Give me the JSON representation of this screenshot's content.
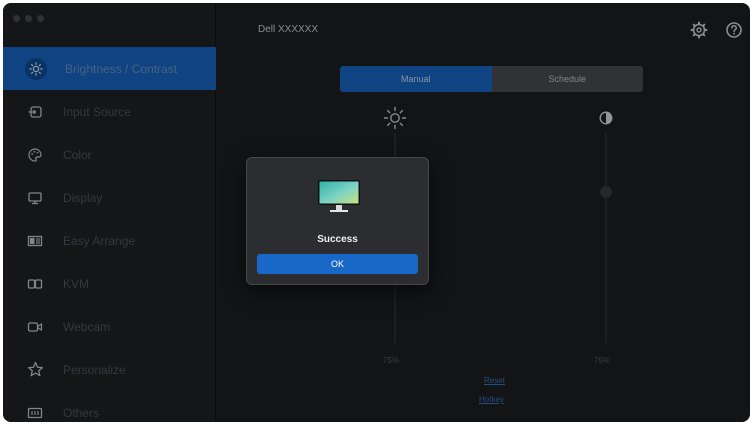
{
  "window": {
    "traffic_lights": [
      "close",
      "minimize",
      "zoom"
    ]
  },
  "header": {
    "monitor_name": "Dell XXXXXX",
    "settings_icon": "gear-icon",
    "help_icon": "help-icon"
  },
  "sidebar": {
    "items": [
      {
        "label": "Brightness / Contrast",
        "icon": "brightness-icon",
        "active": true
      },
      {
        "label": "Input Source",
        "icon": "input-source-icon",
        "active": false
      },
      {
        "label": "Color",
        "icon": "color-palette-icon",
        "active": false
      },
      {
        "label": "Display",
        "icon": "display-icon",
        "active": false
      },
      {
        "label": "Easy Arrange",
        "icon": "easy-arrange-icon",
        "active": false
      },
      {
        "label": "KVM",
        "icon": "kvm-icon",
        "active": false
      },
      {
        "label": "Webcam",
        "icon": "webcam-icon",
        "active": false
      },
      {
        "label": "Personalize",
        "icon": "star-icon",
        "active": false
      },
      {
        "label": "Others",
        "icon": "others-icon",
        "active": false
      }
    ]
  },
  "mode_toggle": {
    "manual": "Manual",
    "schedule": "Schedule",
    "selected": "Manual"
  },
  "brightness": {
    "value_label": "75%",
    "value": 75,
    "icon": "sun-icon"
  },
  "contrast": {
    "value_label": "75%",
    "value": 75,
    "icon": "contrast-icon"
  },
  "links": {
    "reset": "Reset",
    "hotkey": "Hotkey"
  },
  "dialog": {
    "title": "Success",
    "ok_label": "OK",
    "icon": "monitor-icon"
  },
  "colors": {
    "accent": "#1868c8",
    "background": "#1d1f22",
    "sidebar": "#202226",
    "dialog": "#2b2d30"
  }
}
